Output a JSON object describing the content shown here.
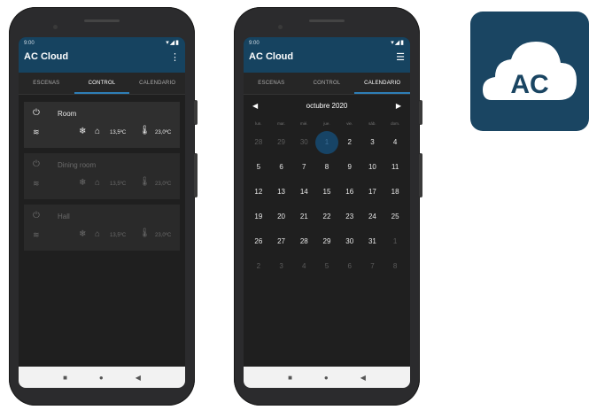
{
  "phone1": {
    "status_time": "9:00",
    "app_title": "AC Cloud",
    "menu_icon": "kebab-menu-icon",
    "tabs": [
      {
        "label": "ESCENAS",
        "active": false
      },
      {
        "label": "CONTROL",
        "active": true
      },
      {
        "label": "CALENDARIO",
        "active": false
      }
    ],
    "devices": [
      {
        "name": "Room",
        "indoor": "13,5ºC",
        "setpoint": "23,0ºC",
        "enabled": true
      },
      {
        "name": "Dining room",
        "indoor": "13,5ºC",
        "setpoint": "23,0ºC",
        "enabled": false
      },
      {
        "name": "Hall",
        "indoor": "13,5ºC",
        "setpoint": "23,0ºC",
        "enabled": false
      }
    ]
  },
  "phone2": {
    "status_time": "9:00",
    "app_title": "AC Cloud",
    "menu_icon": "list-menu-icon",
    "tabs": [
      {
        "label": "ESCENAS",
        "active": false
      },
      {
        "label": "CONTROL",
        "active": false
      },
      {
        "label": "CALENDARIO",
        "active": true
      }
    ],
    "calendar": {
      "month": "octubre 2020",
      "weekdays": [
        "lun.",
        "mar.",
        "mié.",
        "jue.",
        "vie.",
        "sáb.",
        "dom."
      ],
      "weeks": [
        [
          {
            "d": "28",
            "o": true
          },
          {
            "d": "29",
            "o": true
          },
          {
            "d": "30",
            "o": true
          },
          {
            "d": "1",
            "o": false,
            "sel": true
          },
          {
            "d": "2",
            "o": false
          },
          {
            "d": "3",
            "o": false
          },
          {
            "d": "4",
            "o": false
          }
        ],
        [
          {
            "d": "5"
          },
          {
            "d": "6"
          },
          {
            "d": "7"
          },
          {
            "d": "8"
          },
          {
            "d": "9"
          },
          {
            "d": "10"
          },
          {
            "d": "11"
          }
        ],
        [
          {
            "d": "12"
          },
          {
            "d": "13"
          },
          {
            "d": "14"
          },
          {
            "d": "15"
          },
          {
            "d": "16"
          },
          {
            "d": "17"
          },
          {
            "d": "18"
          }
        ],
        [
          {
            "d": "19"
          },
          {
            "d": "20"
          },
          {
            "d": "21"
          },
          {
            "d": "22"
          },
          {
            "d": "23"
          },
          {
            "d": "24"
          },
          {
            "d": "25"
          }
        ],
        [
          {
            "d": "26"
          },
          {
            "d": "27"
          },
          {
            "d": "28"
          },
          {
            "d": "29"
          },
          {
            "d": "30"
          },
          {
            "d": "31"
          },
          {
            "d": "1",
            "o": true
          }
        ],
        [
          {
            "d": "2",
            "o": true
          },
          {
            "d": "3",
            "o": true
          },
          {
            "d": "4",
            "o": true
          },
          {
            "d": "5",
            "o": true
          },
          {
            "d": "6",
            "o": true
          },
          {
            "d": "7",
            "o": true
          },
          {
            "d": "8",
            "o": true
          }
        ]
      ]
    }
  },
  "logo": {
    "text": "AC"
  },
  "colors": {
    "brand": "#164360",
    "accent": "#2e7eb6",
    "background": "#1f1f1f"
  }
}
